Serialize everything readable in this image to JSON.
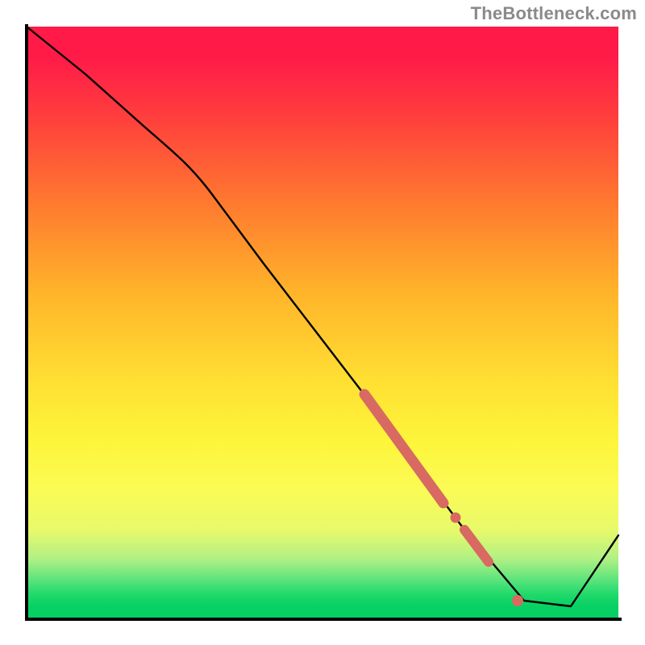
{
  "watermark": "TheBottleneck.com",
  "colors": {
    "gradient_top": "#ff1a48",
    "gradient_bottom": "#06cf63",
    "line": "#000000",
    "marker": "#d86a62",
    "axis": "#000000"
  },
  "chart_data": {
    "type": "line",
    "title": "",
    "xlabel": "",
    "ylabel": "",
    "xlim": [
      0,
      100
    ],
    "ylim": [
      0,
      100
    ],
    "grid": false,
    "legend": false,
    "annotations": [
      "TheBottleneck.com"
    ],
    "series": [
      {
        "name": "bottleneck-curve",
        "x": [
          0,
          10,
          20,
          28,
          40,
          50,
          60,
          68,
          74,
          79,
          84,
          92,
          100
        ],
        "y": [
          100,
          92,
          83,
          76,
          60,
          47,
          34,
          23,
          15,
          9,
          3,
          2,
          14
        ]
      }
    ],
    "markers": [
      {
        "name": "highlight-band-1",
        "style": "thick",
        "x": [
          57,
          70.5
        ],
        "y": [
          38,
          19.5
        ]
      },
      {
        "name": "highlight-dot-1",
        "style": "dot",
        "x": 72.5,
        "y": 17
      },
      {
        "name": "highlight-band-2",
        "style": "thick-short",
        "x": [
          74,
          78
        ],
        "y": [
          15,
          9.5
        ]
      },
      {
        "name": "highlight-dot-2",
        "style": "dot",
        "x": 83,
        "y": 3
      }
    ]
  }
}
